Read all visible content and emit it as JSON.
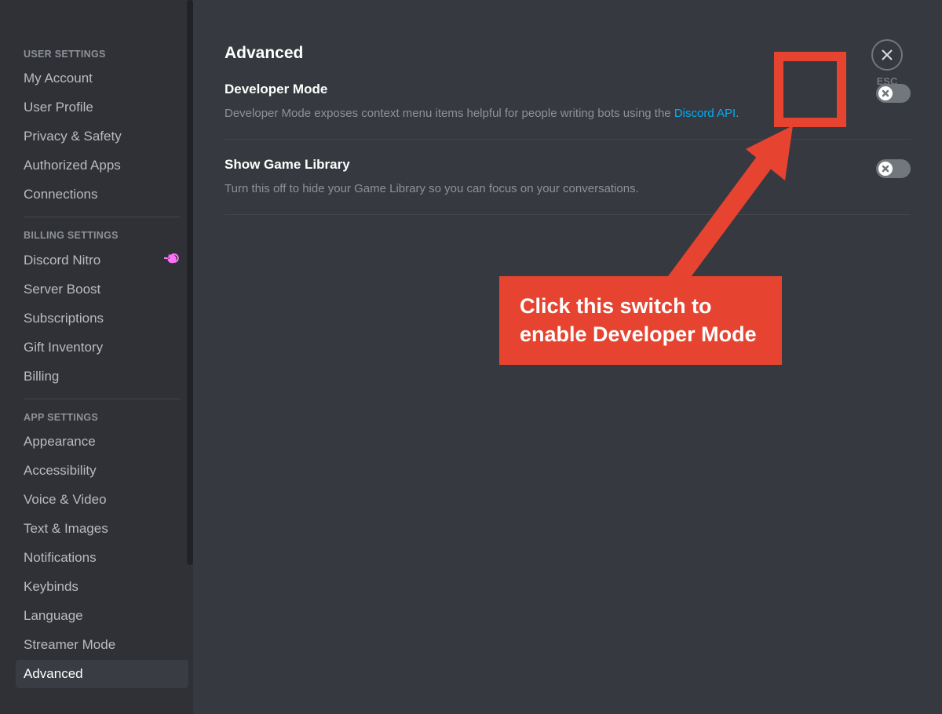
{
  "sidebar": {
    "sections": [
      {
        "header": "USER SETTINGS",
        "items": [
          {
            "label": "My Account",
            "id": "my-account"
          },
          {
            "label": "User Profile",
            "id": "user-profile"
          },
          {
            "label": "Privacy & Safety",
            "id": "privacy-safety"
          },
          {
            "label": "Authorized Apps",
            "id": "authorized-apps"
          },
          {
            "label": "Connections",
            "id": "connections"
          }
        ]
      },
      {
        "header": "BILLING SETTINGS",
        "items": [
          {
            "label": "Discord Nitro",
            "id": "discord-nitro",
            "badge": "nitro"
          },
          {
            "label": "Server Boost",
            "id": "server-boost"
          },
          {
            "label": "Subscriptions",
            "id": "subscriptions"
          },
          {
            "label": "Gift Inventory",
            "id": "gift-inventory"
          },
          {
            "label": "Billing",
            "id": "billing"
          }
        ]
      },
      {
        "header": "APP SETTINGS",
        "items": [
          {
            "label": "Appearance",
            "id": "appearance"
          },
          {
            "label": "Accessibility",
            "id": "accessibility"
          },
          {
            "label": "Voice & Video",
            "id": "voice-video"
          },
          {
            "label": "Text & Images",
            "id": "text-images"
          },
          {
            "label": "Notifications",
            "id": "notifications"
          },
          {
            "label": "Keybinds",
            "id": "keybinds"
          },
          {
            "label": "Language",
            "id": "language"
          },
          {
            "label": "Streamer Mode",
            "id": "streamer-mode"
          },
          {
            "label": "Advanced",
            "id": "advanced",
            "active": true
          }
        ]
      }
    ]
  },
  "main": {
    "title": "Advanced",
    "settings": [
      {
        "id": "developer-mode",
        "title": "Developer Mode",
        "desc_prefix": "Developer Mode exposes context menu items helpful for people writing bots using the ",
        "link_text": "Discord API",
        "desc_suffix": ".",
        "toggle_state": false
      },
      {
        "id": "show-game-library",
        "title": "Show Game Library",
        "desc": "Turn this off to hide your Game Library so you can focus on your conversations.",
        "toggle_state": false
      }
    ]
  },
  "close": {
    "label": "ESC"
  },
  "callout": {
    "text": "Click this switch to enable Developer Mode"
  },
  "colors": {
    "accent_red": "#e64430",
    "link_blue": "#00aff4",
    "nitro_pink": "#ff73fa"
  }
}
